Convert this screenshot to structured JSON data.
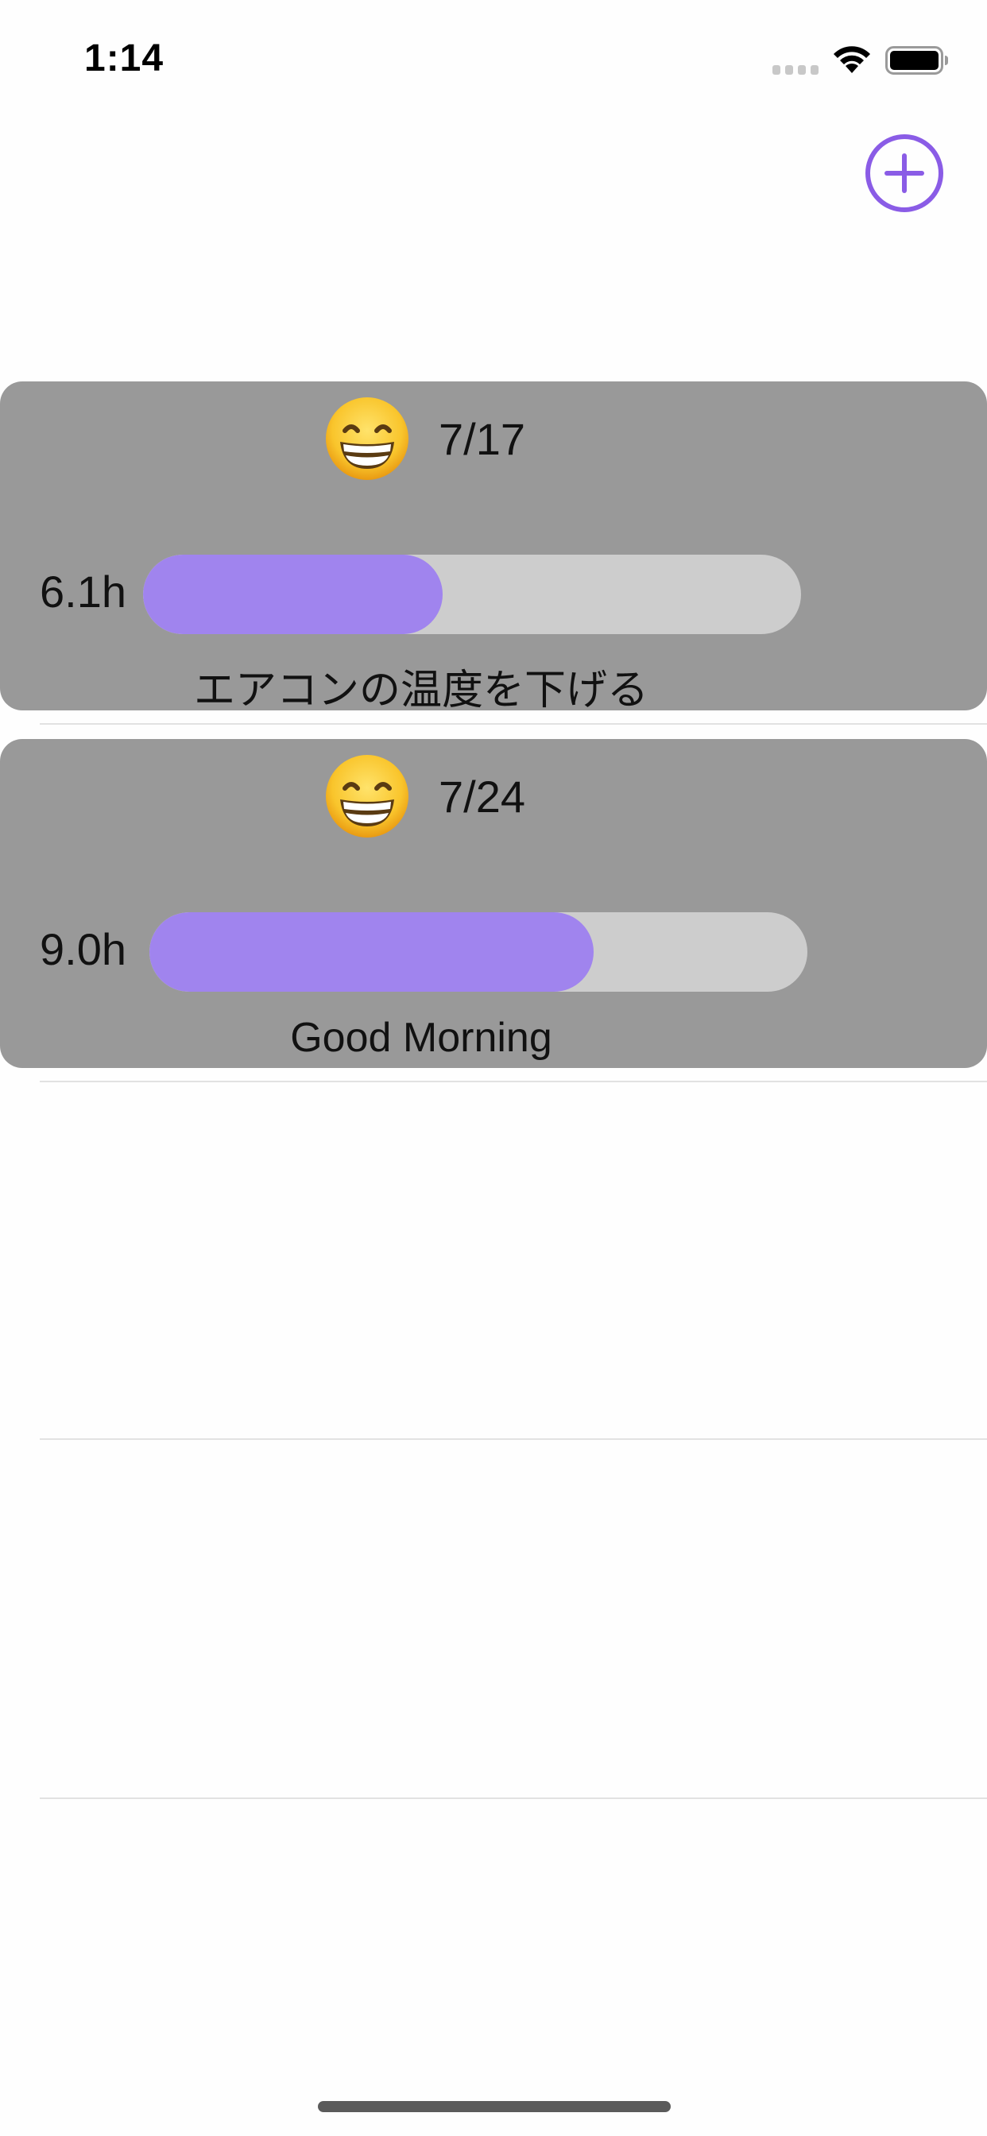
{
  "status_bar": {
    "time": "1:14",
    "icons": [
      "cellular-signal-icon",
      "wifi-icon",
      "battery-icon"
    ]
  },
  "nav": {
    "add_icon": "plus-circle-icon",
    "accent_color": "#8a5ce6"
  },
  "entries": [
    {
      "emoji_icon": "grinning-face-icon",
      "date": "7/17",
      "hours": "6.1h",
      "progress": 0.455,
      "note": "エアコンの温度を下げる"
    },
    {
      "emoji_icon": "grinning-face-icon",
      "date": "7/24",
      "hours": "9.0h",
      "progress": 0.675,
      "note": "Good Morning"
    }
  ],
  "colors": {
    "card_background": "#999999",
    "progress_track": "#cdcdcd",
    "progress_fill": "#a084ee"
  }
}
